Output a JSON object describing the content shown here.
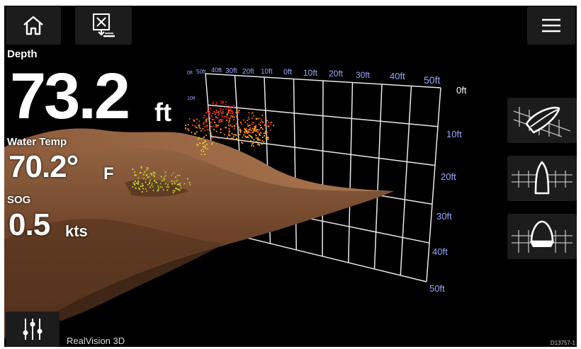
{
  "toolbar": {
    "home_icon": "home-icon",
    "waypoint_icon": "waypoint-icon",
    "menu_icon": "hamburger-menu-icon",
    "settings_icon": "sliders-icon"
  },
  "data_overlay": {
    "depth": {
      "label": "Depth",
      "value": "73.2",
      "unit": "ft"
    },
    "water_temp": {
      "label": "Water Temp",
      "value": "70.2°",
      "unit": "F"
    },
    "sog": {
      "label": "SOG",
      "value": "0.5",
      "unit": "kts"
    }
  },
  "sonar_grid": {
    "top_labels": [
      "50ft",
      "40ft",
      "30ft",
      "20ft",
      "10ft",
      "0ft",
      "10ft",
      "20ft",
      "30ft",
      "40ft",
      "50ft"
    ],
    "top_first_label": "0ft",
    "left_small_label": "10ft",
    "right_labels": [
      "0ft",
      "10ft",
      "20ft",
      "30ft",
      "40ft",
      "50ft"
    ]
  },
  "view_buttons": [
    {
      "name": "isometric-view",
      "icon": "boat-iso-icon"
    },
    {
      "name": "front-view",
      "icon": "boat-front-icon"
    },
    {
      "name": "rear-view",
      "icon": "boat-rear-icon"
    }
  ],
  "colors": {
    "background": "#000000",
    "button": "#1c1c1c",
    "grid": "#e8e8e8",
    "grid_label": "#9aa8ff",
    "seabed": "#8a5a3a"
  },
  "app_label": "RealVision 3D",
  "image_code": "D13757-1"
}
